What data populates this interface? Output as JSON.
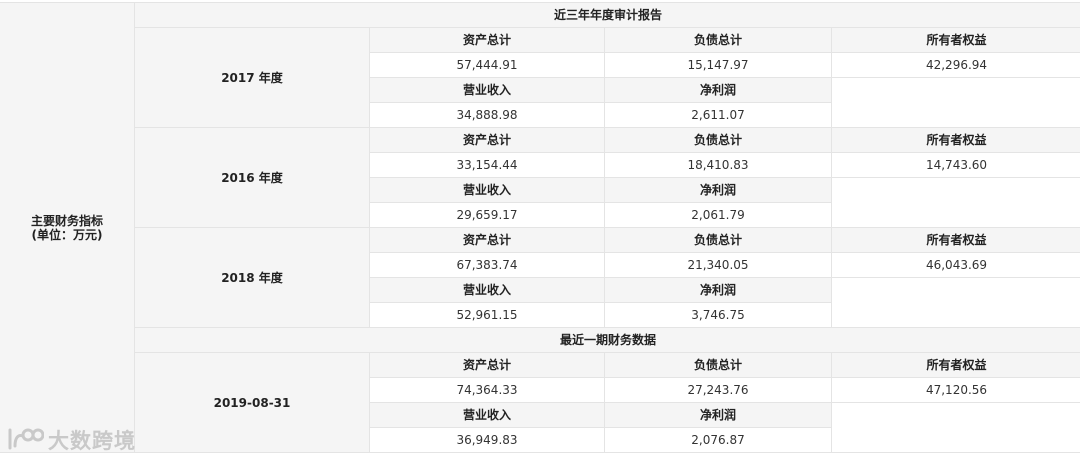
{
  "table": {
    "main_label": "主要财务指标\n(单位：万元)",
    "sections": [
      {
        "title": "近三年年度审计报告",
        "blocks": [
          {
            "period": "2017 年度",
            "headers1": [
              "资产总计",
              "负债总计",
              "所有者权益"
            ],
            "values1": [
              "57,444.91",
              "15,147.97",
              "42,296.94"
            ],
            "headers2": [
              "营业收入",
              "净利润"
            ],
            "values2": [
              "34,888.98",
              "2,611.07"
            ]
          },
          {
            "period": "2016 年度",
            "headers1": [
              "资产总计",
              "负债总计",
              "所有者权益"
            ],
            "values1": [
              "33,154.44",
              "18,410.83",
              "14,743.60"
            ],
            "headers2": [
              "营业收入",
              "净利润"
            ],
            "values2": [
              "29,659.17",
              "2,061.79"
            ]
          },
          {
            "period": "2018 年度",
            "headers1": [
              "资产总计",
              "负债总计",
              "所有者权益"
            ],
            "values1": [
              "67,383.74",
              "21,340.05",
              "46,043.69"
            ],
            "headers2": [
              "营业收入",
              "净利润"
            ],
            "values2": [
              "52,961.15",
              "3,746.75"
            ]
          }
        ]
      },
      {
        "title": "最近一期财务数据",
        "blocks": [
          {
            "period": "2019-08-31",
            "headers1": [
              "资产总计",
              "负债总计",
              "所有者权益"
            ],
            "values1": [
              "74,364.33",
              "27,243.76",
              "47,120.56"
            ],
            "headers2": [
              "营业收入",
              "净利润"
            ],
            "values2": [
              "36,949.83",
              "2,076.87"
            ]
          }
        ]
      }
    ]
  },
  "watermark": {
    "text": "大数跨境",
    "icon": "logo-icon"
  }
}
